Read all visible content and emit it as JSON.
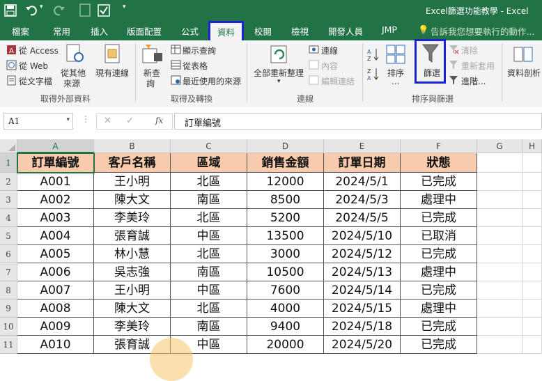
{
  "window": {
    "title": "Excel篩選功能教學 - Excel"
  },
  "quick_access": {
    "save_icon": "save-icon",
    "undo_icon": "undo-icon",
    "redo_icon": "redo-icon"
  },
  "tabs": [
    "檔案",
    "常用",
    "插入",
    "版面配置",
    "公式",
    "資料",
    "校閱",
    "檢視",
    "開發人員",
    "JMP"
  ],
  "active_tab": "資料",
  "tell_me": "告訴我您想要執行的動作...",
  "ribbon": {
    "get_external": {
      "from_access": "從 Access",
      "from_web": "從 Web",
      "from_text": "從文字檔",
      "other_sources": "從其他",
      "other_sources_2": "來源",
      "existing": "現有連線",
      "group": "取得外部資料"
    },
    "get_transform": {
      "new_query": "新查",
      "new_query_2": "詢",
      "show_queries": "顯示查詢",
      "from_table": "從表格",
      "recent_sources": "最近使用的來源",
      "group": "取得及轉換"
    },
    "connections": {
      "refresh_all": "全部重新整理",
      "connections": "連線",
      "properties": "內容",
      "edit_links": "編輯連結",
      "group": "連線"
    },
    "sort_filter": {
      "sort": "排序",
      "sort_dots": "...",
      "filter": "篩選",
      "clear": "清除",
      "reapply": "重新套用",
      "advanced": "進階...",
      "group": "排序與篩選"
    },
    "data_tools": {
      "text_to_columns": "資料剖析"
    }
  },
  "formula_bar": {
    "name_box": "A1",
    "cancel": "✕",
    "enter": "✓",
    "fx": "fx",
    "content": "訂單編號"
  },
  "columns": [
    "A",
    "B",
    "C",
    "D",
    "E",
    "F",
    "G",
    "H"
  ],
  "rows": [
    "1",
    "2",
    "3",
    "4",
    "5",
    "6",
    "7",
    "8",
    "9",
    "10",
    "11"
  ],
  "table": {
    "headers": [
      "訂單編號",
      "客戶名稱",
      "區域",
      "銷售金額",
      "訂單日期",
      "狀態"
    ],
    "rows": [
      [
        "A001",
        "王小明",
        "北區",
        "12000",
        "2024/5/1",
        "已完成"
      ],
      [
        "A002",
        "陳大文",
        "南區",
        "8500",
        "2024/5/3",
        "處理中"
      ],
      [
        "A003",
        "李美玲",
        "北區",
        "5200",
        "2024/5/5",
        "已完成"
      ],
      [
        "A004",
        "張育誠",
        "中區",
        "13500",
        "2024/5/10",
        "已取消"
      ],
      [
        "A005",
        "林小慧",
        "北區",
        "3000",
        "2024/5/12",
        "已完成"
      ],
      [
        "A006",
        "吳志強",
        "南區",
        "10500",
        "2024/5/13",
        "處理中"
      ],
      [
        "A007",
        "王小明",
        "中區",
        "7600",
        "2024/5/14",
        "已完成"
      ],
      [
        "A008",
        "陳大文",
        "北區",
        "4000",
        "2024/5/15",
        "處理中"
      ],
      [
        "A009",
        "李美玲",
        "南區",
        "9400",
        "2024/5/18",
        "已完成"
      ],
      [
        "A010",
        "張育誠",
        "中區",
        "20000",
        "2024/5/20",
        "已完成"
      ]
    ]
  },
  "colors": {
    "brand": "#217346",
    "header_fill": "#f8cbad",
    "highlight": "#1a22d4"
  }
}
